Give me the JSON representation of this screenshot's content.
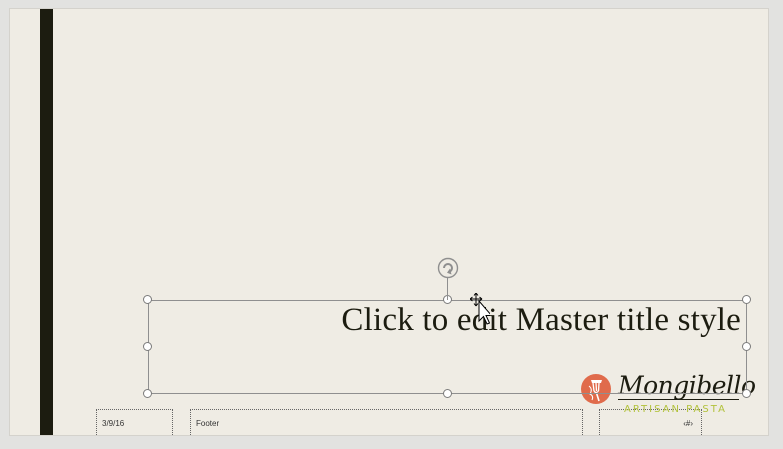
{
  "slide": {
    "title_placeholder": "Click to edit Master title style",
    "date": "3/9/16",
    "footer": "Footer",
    "slide_number": "‹#›"
  },
  "logo": {
    "name": "Mongibello",
    "tagline": "ARTISAN PASTA"
  },
  "colors": {
    "background": "#efece4",
    "accent_bar": "#1c1c10",
    "logo_circle": "#e06b4b",
    "tagline": "#b2c23c"
  },
  "icons": [
    "rotate-handle-icon",
    "move-cursor-icon",
    "pasta-fork-icon"
  ]
}
